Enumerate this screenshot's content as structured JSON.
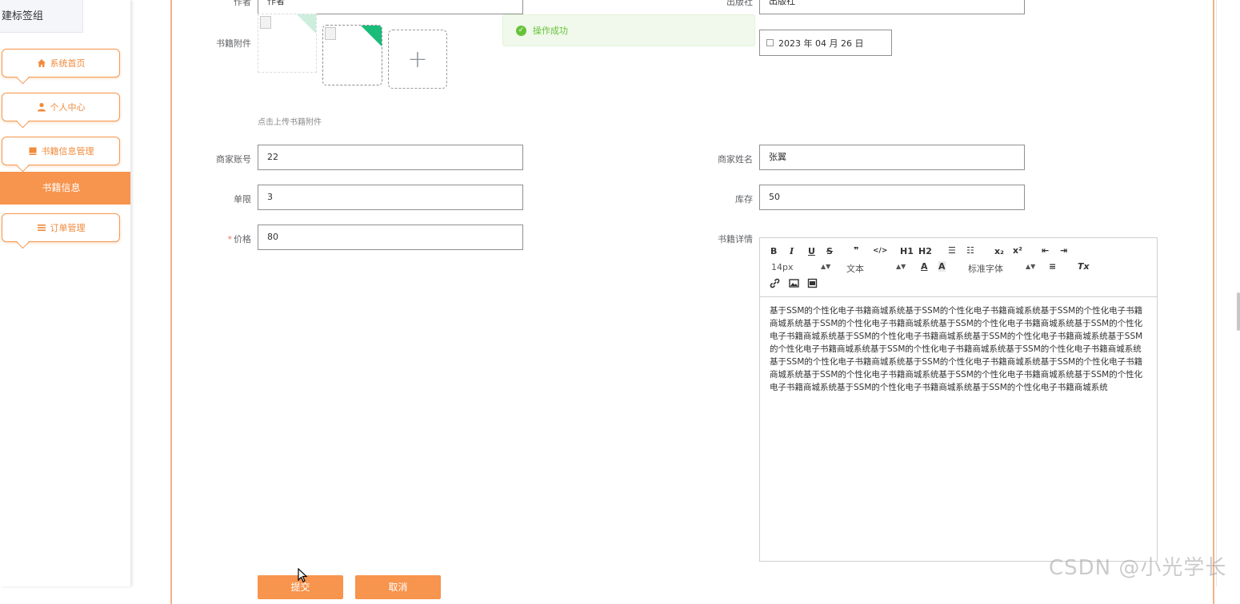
{
  "sidebar": {
    "bookmark_chip": "建标签组",
    "items": [
      {
        "label": "系统首页",
        "icon": "home-icon"
      },
      {
        "label": "个人中心",
        "icon": "user-icon"
      },
      {
        "label": "书籍信息管理",
        "icon": "book-icon"
      },
      {
        "label": "书籍信息",
        "icon": null,
        "active": true
      },
      {
        "label": "订单管理",
        "icon": "list-icon"
      }
    ]
  },
  "form": {
    "author": {
      "label": "作者",
      "value": "作者"
    },
    "publisher": {
      "label": "出版社",
      "value": "出版社"
    },
    "attachment": {
      "label": "书籍附件",
      "hint": "点击上传书籍附件",
      "plus": "+"
    },
    "publish_date": {
      "value": "2023 年 04 月 26 日"
    },
    "merchant_account": {
      "label": "商家账号",
      "value": "22"
    },
    "merchant_name": {
      "label": "商家姓名",
      "value": "张翼"
    },
    "limit": {
      "label": "单限",
      "value": "3"
    },
    "stock": {
      "label": "库存",
      "value": "50"
    },
    "price": {
      "label": "价格",
      "required_mark": "*",
      "value": "80"
    },
    "details": {
      "label": "书籍详情",
      "toolbar": {
        "bold": "B",
        "italic": "I",
        "underline": "U",
        "strike": "S",
        "quote": "❞",
        "code": "</>",
        "h1": "H1",
        "h2": "H2",
        "ordered_list": "☰",
        "bullet_list": "☷",
        "subscript": "x₂",
        "superscript": "x²",
        "outdent": "⇤",
        "indent": "⇥",
        "font_size": "14px",
        "text_type": "文本",
        "font_color": "A",
        "bg_color": "A",
        "font_family": "标准字体",
        "align": "≡",
        "clear": "Tx"
      },
      "content": "基于SSM的个性化电子书籍商城系统基于SSM的个性化电子书籍商城系统基于SSM的个性化电子书籍商城系统基于SSM的个性化电子书籍商城系统基于SSM的个性化电子书籍商城系统基于SSM的个性化电子书籍商城系统基于SSM的个性化电子书籍商城系统基于SSM的个性化电子书籍商城系统基于SSM的个性化电子书籍商城系统基于SSM的个性化电子书籍商城系统基于SSM的个性化电子书籍商城系统基于SSM的个性化电子书籍商城系统基于SSM的个性化电子书籍商城系统基于SSM的个性化电子书籍商城系统基于SSM的个性化电子书籍商城系统基于SSM的个性化电子书籍商城系统基于SSM的个性化电子书籍商城系统基于SSM的个性化电子书籍商城系统基于SSM的个性化电子书籍商城系统"
    }
  },
  "toast": {
    "message": "操作成功"
  },
  "buttons": {
    "submit": "提交",
    "cancel": "取消"
  },
  "watermark": "CSDN @小光学长",
  "colors": {
    "accent": "#f7944d",
    "success": "#67c23a",
    "badge": "#1abc7a"
  }
}
